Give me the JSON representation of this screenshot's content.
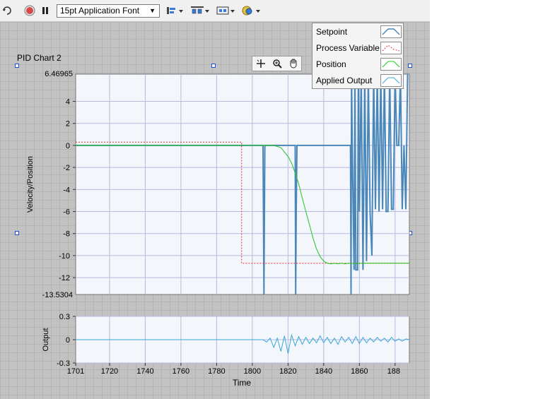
{
  "toolbar": {
    "font_select_value": "15pt Application Font"
  },
  "chart": {
    "title": "PID Chart 2",
    "main_ylabel": "Velocity/Position",
    "output_ylabel": "Output",
    "xlabel": "Time",
    "main_ymax_label": "6.46965",
    "main_ymin_label": "-13.5304",
    "main_ytick_labels": [
      "4",
      "2",
      "0",
      "-2",
      "-4",
      "-6",
      "-8",
      "-10",
      "-12"
    ],
    "output_ytick_labels": [
      "0.3",
      "0",
      "-0.3"
    ],
    "xtick_labels": [
      "1701",
      "1720",
      "1740",
      "1760",
      "1780",
      "1800",
      "1820",
      "1840",
      "1860",
      "188"
    ]
  },
  "legend": [
    {
      "label": "Setpoint",
      "color": "#4a86b8"
    },
    {
      "label": "Process Variable",
      "color": "#e83030"
    },
    {
      "label": "Position",
      "color": "#1ec81e"
    },
    {
      "label": "Applied Output",
      "color": "#3aa8d8"
    }
  ],
  "chart_data": {
    "type": "line",
    "xlabel": "Time",
    "ylabel": "Velocity/Position",
    "xlim": [
      1701,
      1888
    ],
    "ylim": [
      -13.5304,
      6.46965
    ],
    "series": [
      {
        "name": "Setpoint",
        "color": "#4a86b8",
        "x": [
          1701,
          1806,
          1806.5,
          1807,
          1824,
          1824.3,
          1824.6,
          1825,
          1855,
          1855.3,
          1855.6,
          1856,
          1857,
          1857.5,
          1858,
          1859,
          1859.4,
          1860,
          1861,
          1862,
          1863,
          1864,
          1865,
          1866,
          1867,
          1868,
          1869,
          1870,
          1871,
          1872,
          1873,
          1874,
          1875,
          1876,
          1877,
          1878,
          1879,
          1880,
          1881,
          1882,
          1883,
          1884,
          1885,
          1886,
          1887,
          1888
        ],
        "y": [
          0,
          0,
          -13.5,
          0,
          0,
          -13.5,
          -5.8,
          0,
          0,
          -13.5,
          6.5,
          0,
          -11.3,
          6.5,
          -11.3,
          -11.3,
          6.5,
          -6,
          6.5,
          -11.3,
          6.5,
          -10.5,
          6.5,
          -6.2,
          -10,
          6.5,
          -5.8,
          6.5,
          -6,
          6.5,
          -5.8,
          6.5,
          -6,
          -6,
          6.5,
          -5.8,
          -5.8,
          6.5,
          0,
          0,
          6.5,
          -5.8,
          0,
          -5.8,
          6.5,
          6.5
        ]
      },
      {
        "name": "Process Variable",
        "color": "#e83030",
        "x": [
          1701,
          1794,
          1794,
          1888
        ],
        "y": [
          0.3,
          0.3,
          -10.7,
          -10.7
        ]
      },
      {
        "name": "Position",
        "color": "#1ec81e",
        "x": [
          1701,
          1808,
          1812,
          1816,
          1818,
          1820,
          1822,
          1824,
          1826,
          1828,
          1830,
          1832,
          1834,
          1836,
          1838,
          1840,
          1842,
          1844,
          1846,
          1848,
          1850,
          1852,
          1854,
          1858,
          1862,
          1870,
          1888
        ],
        "y": [
          0,
          0,
          0,
          -0.2,
          -0.6,
          -1.0,
          -1.6,
          -2.5,
          -3.5,
          -4.8,
          -6.0,
          -7.2,
          -8.4,
          -9.4,
          -10.1,
          -10.5,
          -10.7,
          -10.75,
          -10.7,
          -10.75,
          -10.7,
          -10.75,
          -10.7,
          -10.72,
          -10.7,
          -10.7,
          -10.7
        ]
      },
      {
        "name": "Applied Output",
        "color": "#3aa8d8",
        "panel": "output",
        "ylim": [
          -0.3,
          0.3
        ],
        "x": [
          1701,
          1806,
          1808,
          1810,
          1812,
          1814,
          1816,
          1818,
          1820,
          1822,
          1824,
          1826,
          1828,
          1830,
          1832,
          1834,
          1836,
          1838,
          1840,
          1842,
          1844,
          1846,
          1848,
          1850,
          1852,
          1854,
          1856,
          1858,
          1860,
          1862,
          1864,
          1866,
          1868,
          1870,
          1872,
          1874,
          1876,
          1878,
          1880,
          1882,
          1884,
          1886,
          1888
        ],
        "y": [
          0,
          0,
          -0.03,
          0.02,
          -0.1,
          0.02,
          -0.15,
          0.05,
          -0.18,
          0.06,
          -0.08,
          0.04,
          -0.06,
          0.03,
          -0.05,
          0.02,
          -0.04,
          0.05,
          -0.04,
          0.03,
          -0.05,
          0.02,
          -0.06,
          0.04,
          -0.03,
          0.03,
          -0.05,
          0.04,
          -0.05,
          0.03,
          -0.04,
          0.02,
          -0.03,
          0.03,
          -0.02,
          0.02,
          -0.03,
          0.03,
          -0.02,
          0.01,
          -0.02,
          0.01,
          0
        ]
      }
    ]
  }
}
